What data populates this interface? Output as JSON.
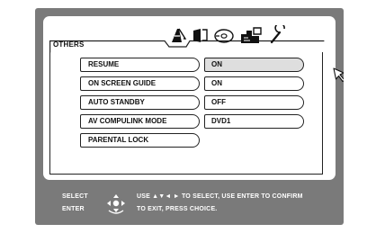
{
  "section": {
    "title": "OTHERS"
  },
  "tab_icons": [
    "picture-tab-icon",
    "sound-tab-icon",
    "disc-tab-icon",
    "language-tab-icon",
    "settings-tab-icon"
  ],
  "menu": {
    "items": [
      {
        "label": "RESUME",
        "value": "ON",
        "selected": true
      },
      {
        "label": "ON SCREEN GUIDE",
        "value": "ON"
      },
      {
        "label": "AUTO STANDBY",
        "value": "OFF"
      },
      {
        "label": "AV COMPULINK MODE",
        "value": "DVD1"
      },
      {
        "label": "PARENTAL LOCK"
      }
    ]
  },
  "help": {
    "select_key": "SELECT",
    "enter_key": "ENTER",
    "line1": "USE ▲▼◄ ► TO SELECT, USE ENTER TO CONFIRM",
    "line2": "TO EXIT, PRESS CHOICE."
  },
  "colors": {
    "frame": "#7a7a7a",
    "panel": "#ffffff",
    "selected_value": "#dedede",
    "text": "#111111",
    "help_text": "#ffffff"
  }
}
